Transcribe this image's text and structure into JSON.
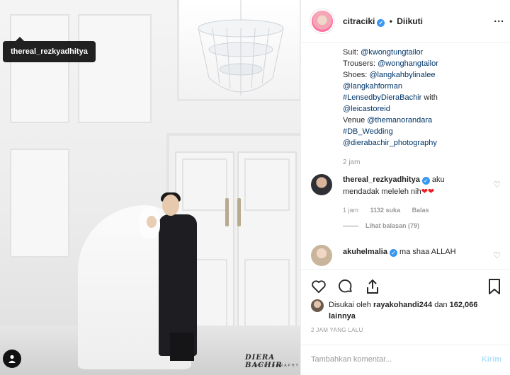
{
  "photo": {
    "tag_username": "thereal_rezkyadhitya",
    "watermark": "DIERA BACHIR",
    "watermark_sub": "PHOTOGRAPHY",
    "tag_icon": "user-tag-icon"
  },
  "header": {
    "username": "citraciki",
    "verified_icon": "verified-badge-icon",
    "separator": "•",
    "follow_status": "Diikuti",
    "more_label": "...",
    "more_icon": "more-options-icon"
  },
  "caption": {
    "lines": [
      {
        "prefix": "Suit: ",
        "link": "@kwongtungtailor"
      },
      {
        "prefix": "Trousers: ",
        "link": "@wonghangtailor"
      },
      {
        "prefix": "Shoes: ",
        "link": "@langkahbylinalee"
      },
      {
        "prefix": "",
        "link": "@langkahforman"
      },
      {
        "prefix": "",
        "link": "#LensedbyDieraBachir",
        "suffix": " with"
      },
      {
        "prefix": "",
        "link": "@leicastoreid"
      },
      {
        "prefix": "Venue ",
        "link": "@themanorandara"
      },
      {
        "prefix": "",
        "link": "#DB_Wedding"
      },
      {
        "prefix": "",
        "link": "@dierabachir_photography"
      }
    ],
    "time": "2 jam"
  },
  "comments": [
    {
      "username": "thereal_rezkyadhitya",
      "text": " aku mendadak meleleh nih",
      "hearts": "❤❤",
      "time": "1 jam",
      "likes": "1132 suka",
      "reply_label": "Balas",
      "view_replies": "Lihat balasan (79)"
    },
    {
      "username": "akuhelmalia",
      "text": " ma shaa ALLAH"
    }
  ],
  "actions": {
    "like_icon": "heart-icon",
    "comment_icon": "comment-icon",
    "share_icon": "share-icon",
    "save_icon": "bookmark-icon"
  },
  "likes": {
    "prefix": "Disukai oleh ",
    "user": "rayakohandi244",
    "middle": " dan ",
    "count": "162,066 lainnya"
  },
  "timestamp": "2 JAM YANG LALU",
  "add_comment": {
    "placeholder": "Tambahkan komentar...",
    "post_label": "Kirim"
  },
  "colors": {
    "link": "#003569",
    "verified": "#3897f0",
    "heart": "#ed1b24",
    "post_disabled": "#b2dffc"
  }
}
